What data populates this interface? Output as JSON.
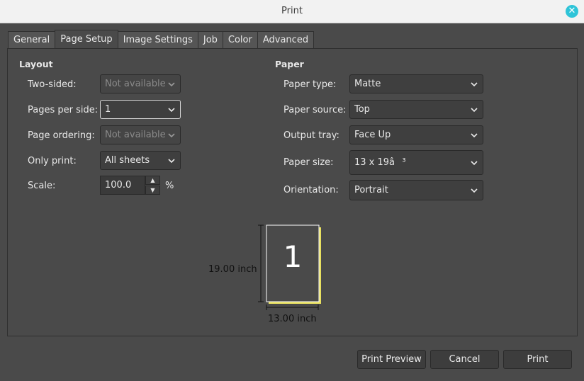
{
  "window": {
    "title": "Print",
    "close_icon": "close-icon"
  },
  "tabs": [
    {
      "label": "General"
    },
    {
      "label": "Page Setup",
      "active": true
    },
    {
      "label": "Image Settings"
    },
    {
      "label": "Job"
    },
    {
      "label": "Color"
    },
    {
      "label": "Advanced"
    }
  ],
  "layout": {
    "title": "Layout",
    "two_sided": {
      "label": "Two-sided:",
      "value": "Not available"
    },
    "pages_per_side": {
      "label": "Pages per side:",
      "value": "1"
    },
    "page_ordering": {
      "label": "Page ordering:",
      "value": "Not available"
    },
    "only_print": {
      "label": "Only print:",
      "value": "All sheets"
    },
    "scale": {
      "label": "Scale:",
      "value": "100.0",
      "unit": "%"
    }
  },
  "paper": {
    "title": "Paper",
    "paper_type": {
      "label": "Paper type:",
      "value": "Matte"
    },
    "paper_source": {
      "label": "Paper source:",
      "value": "Top"
    },
    "output_tray": {
      "label": "Output tray:",
      "value": "Face Up"
    },
    "paper_size": {
      "label": "Paper size:",
      "value": "13 x 19â³"
    },
    "orientation": {
      "label": "Orientation:",
      "value": "Portrait"
    }
  },
  "preview": {
    "page_number": "1",
    "height_label": "19.00 inch",
    "width_label": "13.00 inch"
  },
  "buttons": {
    "print_preview": "Print Preview",
    "cancel": "Cancel",
    "print": "Print"
  },
  "colors": {
    "background": "#4a4a4a",
    "accent_close": "#2ec4d8",
    "page_shadow": "#e8e060"
  }
}
